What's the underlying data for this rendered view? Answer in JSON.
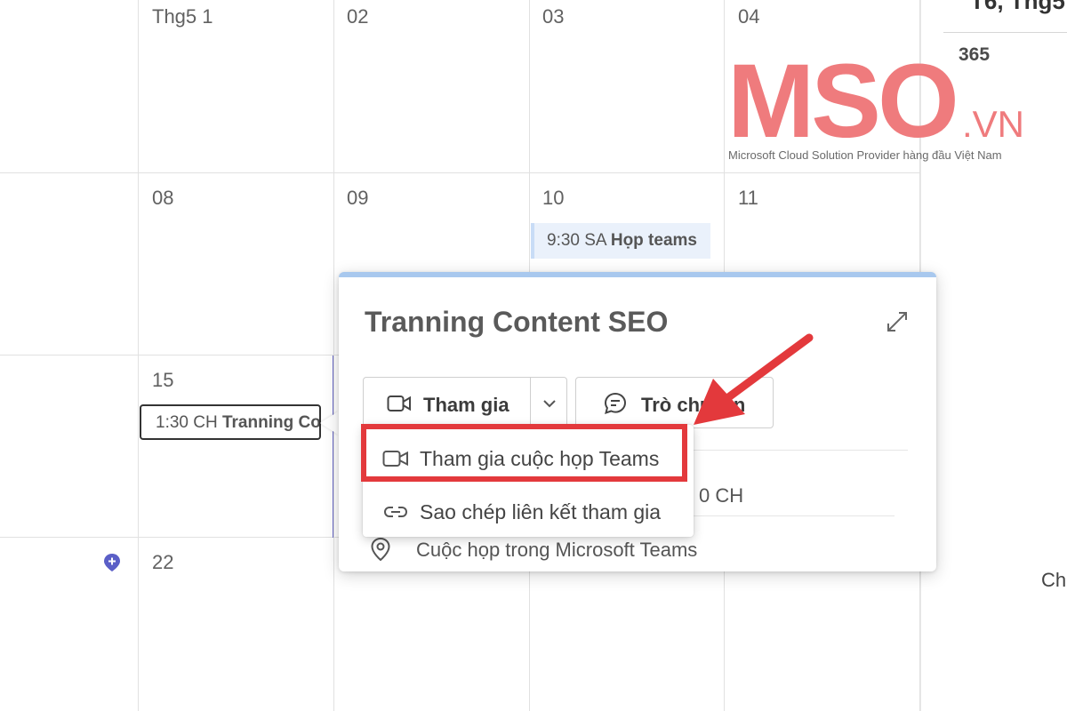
{
  "calendar": {
    "days": {
      "r0c1": "Thg5 1",
      "r0c2": "02",
      "r0c3": "03",
      "r0c4": "04",
      "r1c1": "08",
      "r1c2": "09",
      "r1c3": "10",
      "r1c4": "11",
      "r2c1": "15",
      "r3c1": "22"
    },
    "events": {
      "hop_time": "9:30 SA",
      "hop_title": "Họp teams",
      "tran_time": "1:30 CH",
      "tran_title": "Tranning Content SEO"
    }
  },
  "right_panel": {
    "title": "T6, Thg5",
    "side_text": "Ch"
  },
  "popover": {
    "title": "Tranning Content SEO",
    "join_button": "Tham gia",
    "chat_button": "Trò chuyện",
    "time_fragment": "0 CH",
    "location": "Cuộc họp trong Microsoft Teams"
  },
  "join_menu": {
    "items": [
      {
        "label": "Tham gia cuộc họp Teams",
        "icon": "video-camera-icon"
      },
      {
        "label": "Sao chép liên kết tham gia",
        "icon": "link-icon"
      }
    ]
  },
  "watermark": {
    "brand": "MSO",
    "domain": ".VN",
    "badge": "365",
    "tagline": "Microsoft Cloud Solution Provider hàng đầu Việt Nam"
  },
  "colors": {
    "highlight": "#e3393c",
    "event_bg": "#eaf1fb",
    "popover_accent": "#a8c8ee",
    "brand_pink": "#ef7b7d"
  }
}
